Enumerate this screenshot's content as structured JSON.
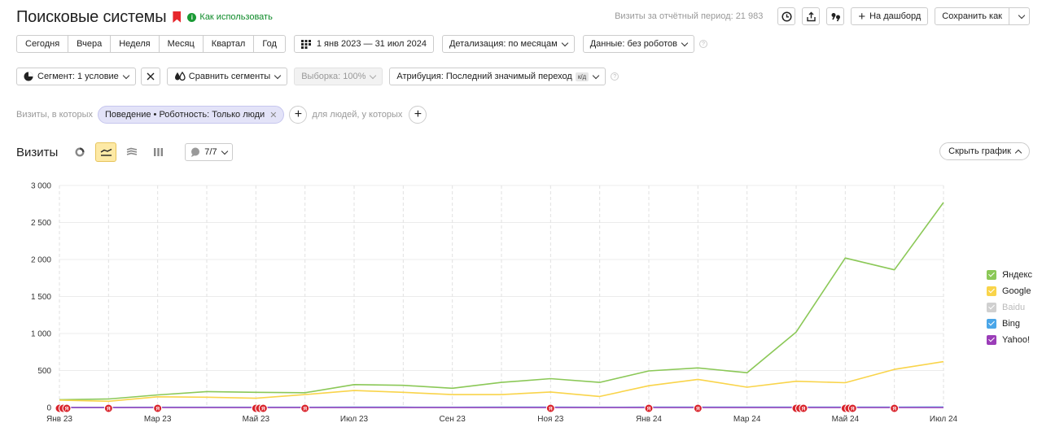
{
  "header": {
    "title": "Поисковые системы",
    "howto": "Как использовать",
    "visits_total": "Визиты за отчётный период: 21 983",
    "to_dashboard": "На дашборд",
    "save_as": "Сохранить как"
  },
  "periods": [
    "Сегодня",
    "Вчера",
    "Неделя",
    "Месяц",
    "Квартал",
    "Год"
  ],
  "date_range": "1 янв 2023 — 31 июл 2024",
  "detail": "Детализация: по месяцам",
  "data_filter": "Данные: без роботов",
  "segment": "Сегмент: 1 условие",
  "compare": "Сравнить сегменты",
  "sample": "Выборка: 100%",
  "attribution": "Атрибуция: Последний значимый переход",
  "attribution_tag": "к/д",
  "filter": {
    "prefix": "Визиты, в которых",
    "chip": "Поведение • Роботность: Только люди",
    "people": "для людей, у которых"
  },
  "chart_header": {
    "title": "Визиты",
    "series_count": "7/7",
    "hide": "Скрыть график"
  },
  "colors": {
    "yandex": "#8bc857",
    "google": "#f9d44a",
    "baidu": "#c8c8c8",
    "bing": "#4aa6e8",
    "yahoo": "#9b3db8",
    "marker": "#d9232b"
  },
  "chart_data": {
    "type": "line",
    "x": [
      "Янв 23",
      "Фев 23",
      "Мар 23",
      "Апр 23",
      "Май 23",
      "Июн 23",
      "Июл 23",
      "Авг 23",
      "Сен 23",
      "Окт 23",
      "Ноя 23",
      "Дек 23",
      "Янв 24",
      "Фев 24",
      "Мар 24",
      "Апр 24",
      "Май 24",
      "Июн 24",
      "Июл 24"
    ],
    "x_tick_labels": [
      "Янв 23",
      "",
      "Мар 23",
      "",
      "Май 23",
      "",
      "Июл 23",
      "",
      "Сен 23",
      "",
      "Ноя 23",
      "",
      "Янв 24",
      "",
      "Мар 24",
      "",
      "Май 24",
      "",
      "Июл 24"
    ],
    "ylim": [
      0,
      3000
    ],
    "y_ticks": [
      0,
      500,
      1000,
      1500,
      2000,
      2500,
      3000
    ],
    "y_tick_labels": [
      "0",
      "500",
      "1 000",
      "1 500",
      "2 000",
      "2 500",
      "3 000"
    ],
    "grid": true,
    "legend": "right",
    "series": [
      {
        "name": "Яндекс",
        "key": "yandex",
        "enabled": true,
        "values": [
          105,
          115,
          170,
          215,
          205,
          200,
          310,
          300,
          260,
          340,
          390,
          340,
          495,
          535,
          470,
          1020,
          2020,
          1860,
          2770
        ]
      },
      {
        "name": "Google",
        "key": "google",
        "enabled": true,
        "values": [
          100,
          85,
          145,
          140,
          125,
          175,
          230,
          205,
          175,
          175,
          210,
          150,
          295,
          380,
          275,
          355,
          335,
          515,
          620
        ]
      },
      {
        "name": "Baidu",
        "key": "baidu",
        "enabled": false,
        "values": [
          0,
          0,
          0,
          0,
          0,
          0,
          0,
          0,
          0,
          0,
          0,
          0,
          0,
          0,
          0,
          0,
          0,
          0,
          0
        ]
      },
      {
        "name": "Bing",
        "key": "bing",
        "enabled": true,
        "values": [
          2,
          2,
          3,
          3,
          3,
          3,
          4,
          4,
          3,
          4,
          4,
          3,
          5,
          5,
          5,
          6,
          6,
          6,
          7
        ]
      },
      {
        "name": "Yahoo!",
        "key": "yahoo",
        "enabled": true,
        "values": [
          0,
          0,
          0,
          0,
          0,
          0,
          0,
          0,
          0,
          0,
          0,
          0,
          0,
          0,
          0,
          0,
          0,
          0,
          0
        ]
      }
    ],
    "annotations": {
      "label": "Я",
      "points": [
        {
          "x": 0,
          "count": 3
        },
        {
          "x": 1,
          "count": 1
        },
        {
          "x": 2,
          "count": 1
        },
        {
          "x": 4,
          "count": 3
        },
        {
          "x": 5,
          "count": 1
        },
        {
          "x": 10,
          "count": 1
        },
        {
          "x": 12,
          "count": 1
        },
        {
          "x": 13,
          "count": 1
        },
        {
          "x": 15,
          "count": 3
        },
        {
          "x": 16,
          "count": 3
        },
        {
          "x": 17,
          "count": 1
        }
      ]
    }
  }
}
